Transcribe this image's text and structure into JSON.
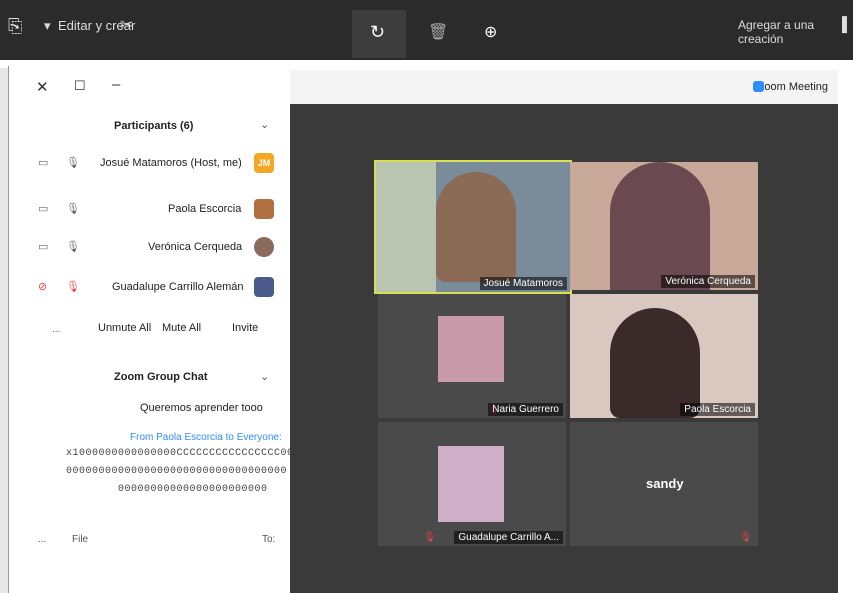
{
  "toolbar": {
    "right_label": "Agregar a una creación",
    "left_label": "Editar y crear",
    "colors": {
      "bg": "#2b2b2b"
    }
  },
  "zoom": {
    "title": "Zoom Meeting",
    "participants_header": "Participants (6)",
    "participants": [
      {
        "name": "Josué Matamoros (Host, me)",
        "initials": "JM",
        "color": "#f5a623"
      },
      {
        "name": "Paola Escorcia",
        "initials": "",
        "color": "#b07040"
      },
      {
        "name": "Verónica Cerqueda",
        "initials": "",
        "color": "#8a6a5a"
      },
      {
        "name": "Guadalupe Carrillo Alemán",
        "initials": "",
        "color": "#4a5a8a"
      }
    ],
    "actions": {
      "invite": "Invite",
      "mute_all": "Mute All",
      "unmute_all": "Unmute All",
      "more": "..."
    },
    "chat_header": "Zoom Group Chat",
    "chat_lines": [
      "Queremos aprender tooo",
      "From Paola Escorcia to Everyone:",
      "x1000000000000000CCCCCCCCCCCCCCCC0000",
      "0000000000000000000000000000000000",
      "00000000000000000000000"
    ],
    "chat_footer": {
      "to": "To:",
      "file": "File",
      "more": "..."
    },
    "tiles": [
      {
        "name": "Josué Matamoros",
        "muted": false
      },
      {
        "name": "Verónica Cerqueda",
        "muted": false
      },
      {
        "name": "Naria Guerrero",
        "muted": true
      },
      {
        "name": "Paola Escorcia",
        "muted": false
      },
      {
        "name": "Guadalupe Carrillo A...",
        "muted": true
      },
      {
        "name": "sandy",
        "muted": true
      }
    ]
  }
}
